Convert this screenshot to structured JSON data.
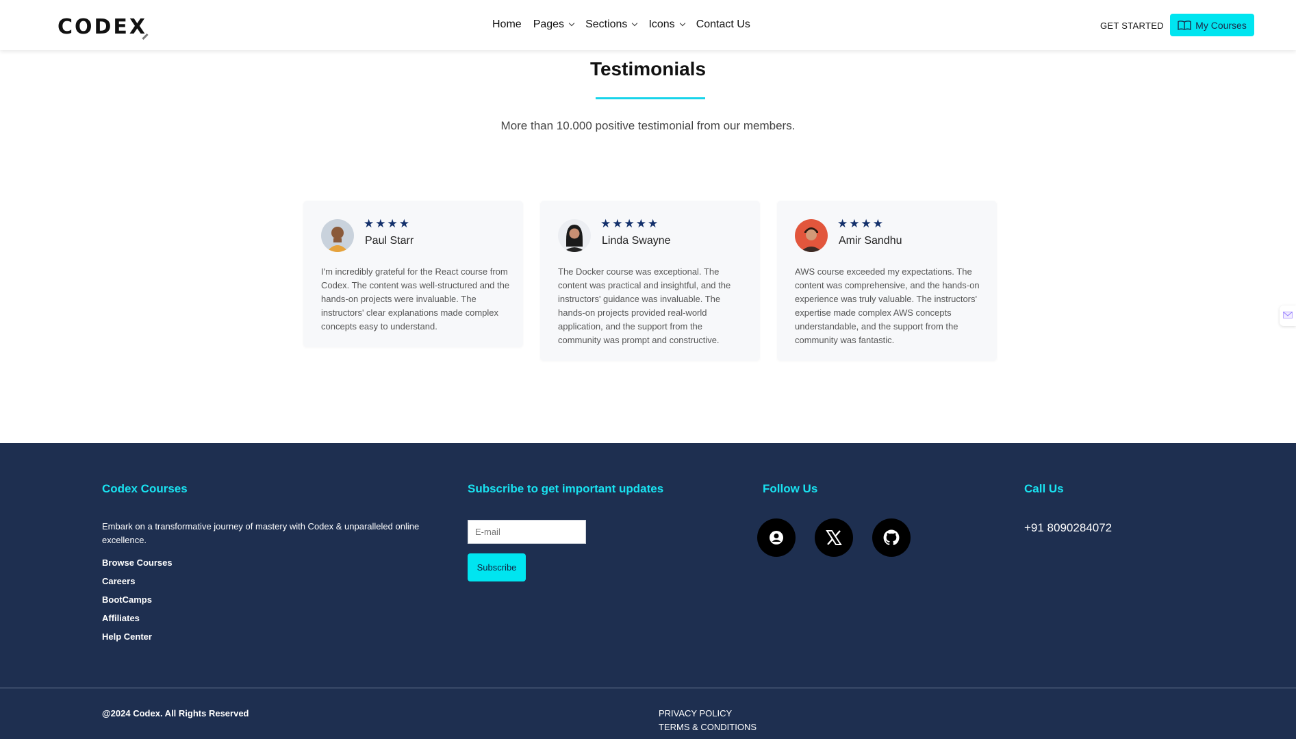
{
  "header": {
    "logo": "CODEX",
    "nav": [
      {
        "label": "Home",
        "dropdown": false
      },
      {
        "label": "Pages",
        "dropdown": true
      },
      {
        "label": "Sections",
        "dropdown": true
      },
      {
        "label": "Icons",
        "dropdown": true
      },
      {
        "label": "Contact Us",
        "dropdown": false
      }
    ],
    "get_started": "GET STARTED",
    "my_courses": "My Courses",
    "my_courses_icon": "book-open-icon"
  },
  "testimonials": {
    "title": "Testimonials",
    "subtitle": "More than 10.000 positive testimonial from our members.",
    "accent_color": "#18d4ea",
    "cards": [
      {
        "stars": 4,
        "name": "Paul Starr",
        "text": "I'm incredibly grateful for the React course from Codex. The content was well-structured and the hands-on projects were invaluable. The instructors' clear explanations made complex concepts easy to understand."
      },
      {
        "stars": 5,
        "name": "Linda Swayne",
        "text": "The Docker course was exceptional. The content was practical and insightful, and the instructors' guidance was invaluable. The hands-on projects provided real-world application, and the support from the community was prompt and constructive."
      },
      {
        "stars": 4,
        "name": "Amir Sandhu",
        "text": "AWS course exceeded my expectations. The content was comprehensive, and the hands-on experience was truly valuable. The instructors' expertise made complex AWS concepts understandable, and the support from the community was fantastic."
      }
    ]
  },
  "footer": {
    "bg_color": "#1e2f50",
    "heading_color": "#19e3f1",
    "about": {
      "heading": "Codex Courses",
      "description": "Embark on a transformative journey of mastery with Codex & unparalleled online excellence.",
      "links": [
        "Browse Courses",
        "Careers",
        "BootCamps",
        "Affiliates",
        "Help Center"
      ]
    },
    "subscribe": {
      "heading": "Subscribe to get important updates",
      "placeholder": "E-mail",
      "button": "Subscribe"
    },
    "follow": {
      "heading": "Follow Us",
      "icons": [
        "user-circle-icon",
        "x-twitter-icon",
        "github-icon"
      ]
    },
    "call": {
      "heading": "Call Us",
      "phone": "+91 8090284072"
    },
    "copyright": "@2024 Codex. All Rights Reserved",
    "legal": [
      "PRIVACY POLICY",
      "TERMS & CONDITIONS"
    ]
  }
}
